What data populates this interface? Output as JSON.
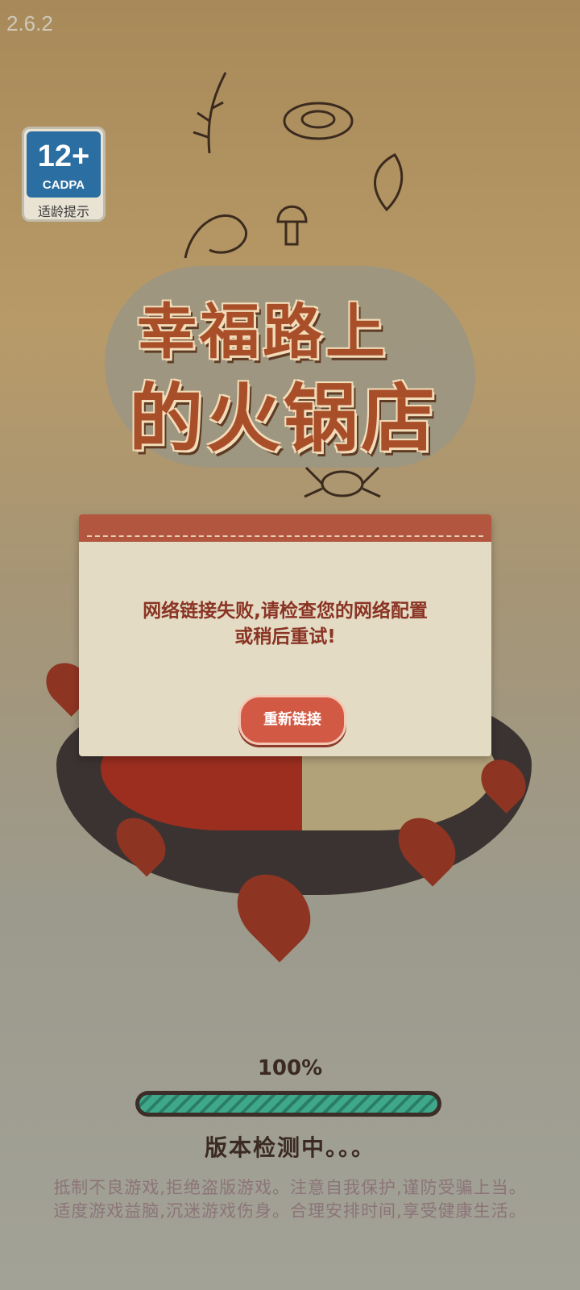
{
  "app": {
    "version": "2.6.2"
  },
  "age_rating": {
    "rating": "12+",
    "org": "CADPA",
    "hint": "适龄提示"
  },
  "game_title": {
    "line1": "幸福路上",
    "line2": "的火锅店"
  },
  "dialog": {
    "message_line1": "网络链接失败,请检查您的网络配置",
    "message_line2": "或稍后重试!",
    "retry_label": "重新链接"
  },
  "loading": {
    "percent_label": "100%",
    "progress_fraction": 1.0,
    "status": "版本检测中。。。"
  },
  "notice": {
    "line1": "抵制不良游戏,拒绝盗版游戏。注意自我保护,谨防受骗上当。",
    "line2": "适度游戏益脑,沉迷游戏伤身。合理安排时间,享受健康生活。"
  },
  "colors": {
    "dialog_header": "#b2563f",
    "dialog_text": "#8a3424",
    "retry_button": "#d25a45",
    "progress_fill": "#3fa88a",
    "title_color": "#a84f2a",
    "age_badge": "#2a6ea2"
  }
}
